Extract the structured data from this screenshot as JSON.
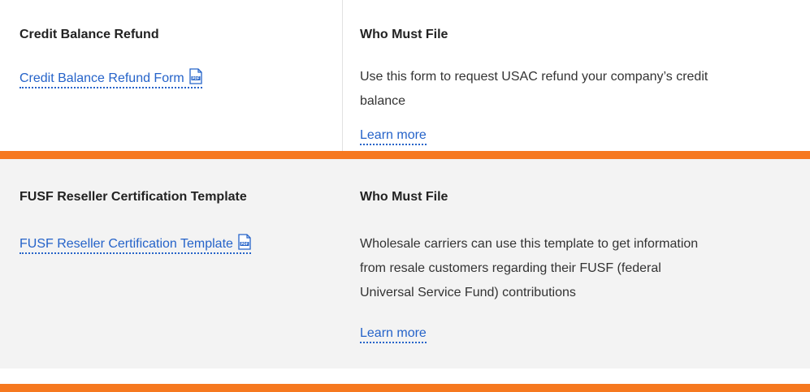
{
  "rows": [
    {
      "title": "Credit Balance Refund",
      "link_text": "Credit Balance Refund Form",
      "link_icon": "pdf-icon",
      "who_heading": "Who Must File",
      "description_lines": [
        "Use this form to request USAC refund your company’s credit",
        "balance"
      ],
      "learn_more": "Learn more"
    },
    {
      "title": "FUSF Reseller Certification Template",
      "link_text": "FUSF Reseller Certification Template",
      "link_icon": "pdf-icon",
      "who_heading": "Who Must File",
      "description_lines": [
        "Wholesale carriers can use this template to get information",
        "from resale customers regarding their FUSF (federal",
        "Universal Service Fund) contributions"
      ],
      "learn_more": "Learn more"
    }
  ],
  "colors": {
    "accent_bar": "#f6781f",
    "link": "#2563c9",
    "row_alt_bg": "#f3f3f3"
  }
}
